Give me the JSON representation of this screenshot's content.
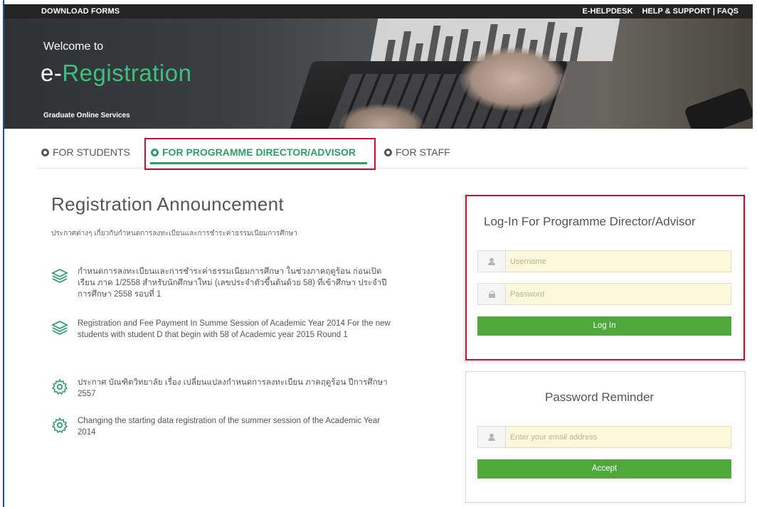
{
  "topbar": {
    "download_forms": "DOWNLOAD FORMS",
    "helpdesk": "E-HELPDESK",
    "help_support": "HELP & SUPPORT | FAQS"
  },
  "hero": {
    "welcome": "Welcome to",
    "title_prefix": "e-",
    "title_main": "Registration",
    "subtitle": "Graduate Online Services"
  },
  "tabs": {
    "students": "FOR STUDENTS",
    "director": "FOR PROGRAMME DIRECTOR/ADVISOR",
    "staff": "FOR STAFF",
    "active": "director"
  },
  "announcement": {
    "title": "Registration Announcement",
    "subtitle": "ประกาศต่างๆ เกี่ยวกับกำหนดการลงทะเบียนและการชำระค่าธรรมเนียมการศึกษา",
    "items": [
      {
        "icon": "layers-icon",
        "text": "กำหนดการลงทะเบียนและการชำระค่าธรรมเนียมการศึกษา ในช่วงภาคฤดูร้อน ก่อนเปิดเรียน ภาค 1/2558 สำหรับนักศึกษาใหม่ (เลขประจำตัวขึ้นต้นด้วย 58) ที่เข้าศึกษา ประจำปีการศึกษา 2558 รอบที่ 1"
      },
      {
        "icon": "layers-icon",
        "text": "Registration and Fee Payment In Summe Session of Academic Year 2014 For the new students with student D that begin with 58 of Academic year 2015 Round 1"
      },
      {
        "icon": "gear-icon",
        "text": "ประกาศ บัณฑิตวิทยาลัย เรื่อง เปลี่ยนแปลงกำหนดการลงทะเบียน ภาคฤดูร้อน ปีการศึกษา 2557"
      },
      {
        "icon": "gear-icon",
        "text": "Changing the starting data registration of the summer session of the Academic Year 2014"
      }
    ]
  },
  "login": {
    "title": "Log-In For Programme Director/Advisor",
    "username_placeholder": "Username",
    "password_placeholder": "Password",
    "button": "Log In"
  },
  "reminder": {
    "title": "Password Reminder",
    "email_placeholder": "Enter your email address",
    "button": "Accept"
  },
  "colors": {
    "accent_green": "#2e9e69",
    "button_green": "#4fa83a",
    "highlight_red": "#c8102e",
    "input_yellow": "#fbf8dc"
  }
}
